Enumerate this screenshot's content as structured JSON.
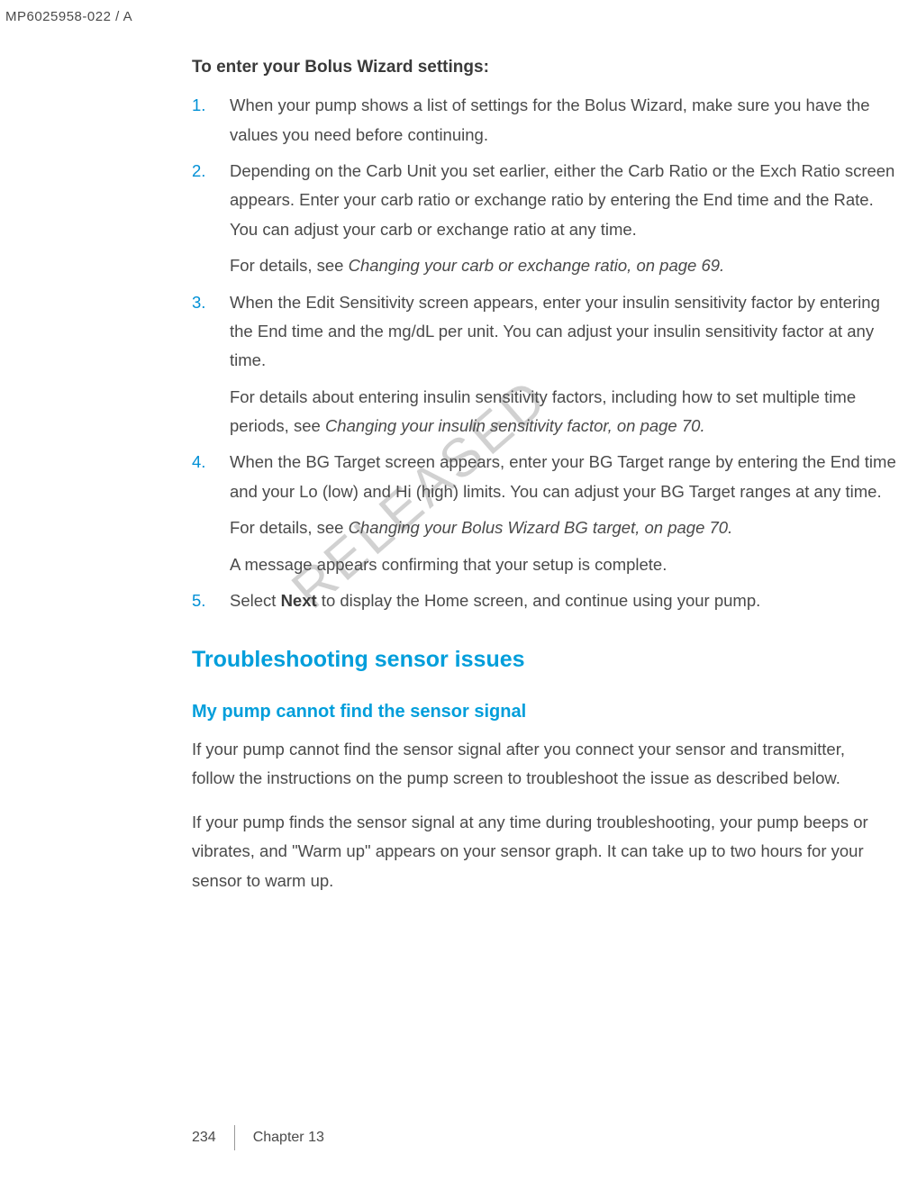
{
  "header_id": "MP6025958-022 / A",
  "watermark": "RELEASED",
  "intro_heading": "To enter your Bolus Wizard settings:",
  "steps": [
    {
      "num": "1.",
      "paras": [
        "When your pump shows a list of settings for the Bolus Wizard, make sure you have the values you need before continuing."
      ]
    },
    {
      "num": "2.",
      "paras": [
        "Depending on the Carb Unit you set earlier, either the Carb Ratio or the Exch Ratio screen appears. Enter your carb ratio or exchange ratio by entering the End time and the Rate. You can adjust your carb or exchange ratio at any time."
      ],
      "ref": "For details, see ",
      "ref_ital": "Changing your carb or exchange ratio, on page 69."
    },
    {
      "num": "3.",
      "paras": [
        "When the Edit Sensitivity screen appears, enter your insulin sensitivity factor by entering the End time and the mg/dL per unit. You can adjust your insulin sensitivity factor at any time."
      ],
      "ref": "For details about entering insulin sensitivity factors, including how to set multiple time periods, see ",
      "ref_ital": "Changing your insulin sensitivity factor, on page 70."
    },
    {
      "num": "4.",
      "paras": [
        "When the BG Target screen appears, enter your BG Target range by entering the End time and your Lo (low) and Hi (high) limits. You can adjust your BG Target ranges at any time."
      ],
      "ref": "For details, see ",
      "ref_ital": "Changing your Bolus Wizard BG target, on page 70.",
      "extra": "A message appears confirming that your setup is complete."
    },
    {
      "num": "5.",
      "pre": "Select ",
      "bold": "Next",
      "post": " to display the Home screen, and continue using your pump."
    }
  ],
  "section_title": "Troubleshooting sensor issues",
  "subsection_title": "My pump cannot find the sensor signal",
  "body_paras": [
    "If your pump cannot find the sensor signal after you connect your sensor and transmitter, follow the instructions on the pump screen to troubleshoot the issue as described below.",
    "If your pump finds the sensor signal at any time during troubleshooting, your pump beeps or vibrates, and \"Warm up\" appears on your sensor graph. It can take up to two hours for your sensor to warm up."
  ],
  "footer": {
    "page": "234",
    "chapter": "Chapter 13"
  }
}
